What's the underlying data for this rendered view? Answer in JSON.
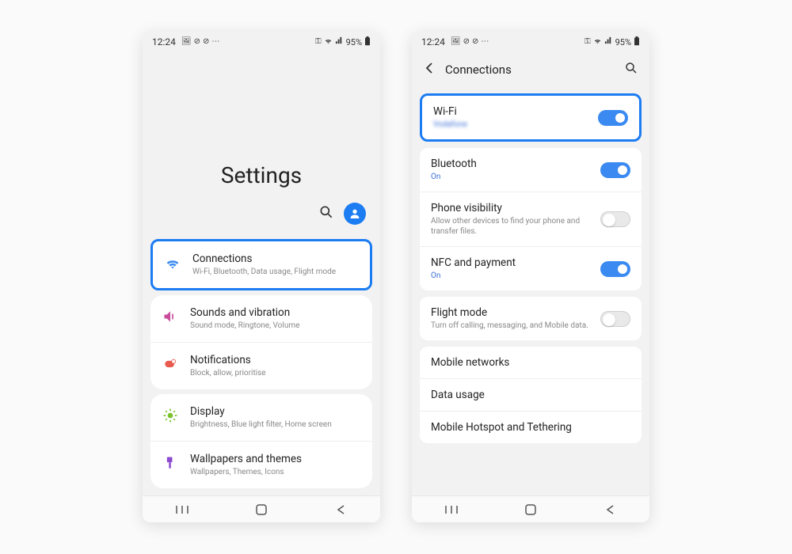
{
  "status": {
    "time": "12:24",
    "battery": "95%"
  },
  "screen1": {
    "title": "Settings",
    "group1": {
      "item1": {
        "label": "Connections",
        "sub": "Wi-Fi, Bluetooth, Data usage, Flight mode"
      }
    },
    "group2": {
      "item1": {
        "label": "Sounds and vibration",
        "sub": "Sound mode, Ringtone, Volume"
      },
      "item2": {
        "label": "Notifications",
        "sub": "Block, allow, prioritise"
      }
    },
    "group3": {
      "item1": {
        "label": "Display",
        "sub": "Brightness, Blue light filter, Home screen"
      },
      "item2": {
        "label": "Wallpapers and themes",
        "sub": "Wallpapers, Themes, Icons"
      }
    }
  },
  "screen2": {
    "title": "Connections",
    "rows": {
      "wifi": {
        "label": "Wi-Fi",
        "sub": "Vodafone"
      },
      "bt": {
        "label": "Bluetooth",
        "sub": "On"
      },
      "visibility": {
        "label": "Phone visibility",
        "sub": "Allow other devices to find your phone and transfer files."
      },
      "nfc": {
        "label": "NFC and payment",
        "sub": "On"
      },
      "flight": {
        "label": "Flight mode",
        "sub": "Turn off calling, messaging, and Mobile data."
      },
      "mobile": {
        "label": "Mobile networks"
      },
      "data": {
        "label": "Data usage"
      },
      "hotspot": {
        "label": "Mobile Hotspot and Tethering"
      }
    }
  }
}
